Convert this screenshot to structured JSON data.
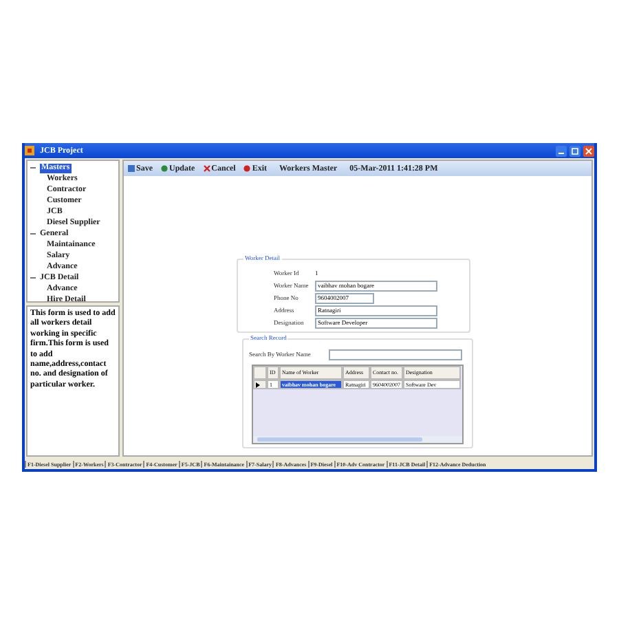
{
  "window": {
    "title": "JCB Project"
  },
  "tree": [
    {
      "label": "Masters",
      "selected": true,
      "expanded": true,
      "children": [
        {
          "label": "Workers"
        },
        {
          "label": "Contractor"
        },
        {
          "label": "Customer"
        },
        {
          "label": "JCB"
        },
        {
          "label": "Diesel Supplier"
        }
      ]
    },
    {
      "label": "General",
      "selected": false,
      "expanded": true,
      "children": [
        {
          "label": "Maintainance"
        },
        {
          "label": "Salary"
        },
        {
          "label": "Advance"
        }
      ]
    },
    {
      "label": "JCB Detail",
      "selected": false,
      "expanded": true,
      "children": [
        {
          "label": "Advance"
        },
        {
          "label": "Hire Detail"
        }
      ]
    }
  ],
  "description": "This form is used to add all workers detail working in specific firm.This form is used to add name,address,contact no. and designation of particular worker.",
  "toolbar": {
    "buttons": [
      {
        "label": "Save",
        "kind": "save"
      },
      {
        "label": "Update",
        "kind": "update"
      },
      {
        "label": "Cancel",
        "kind": "cancel"
      },
      {
        "label": "Exit",
        "kind": "exit"
      }
    ],
    "title": "Workers Master",
    "datetime": "05-Mar-2011 1:41:28 PM"
  },
  "worker_detail": {
    "legend": "Worker Detail",
    "fields": [
      {
        "label": "Worker Id",
        "value": "1",
        "kind": "text"
      },
      {
        "label": "Worker Name",
        "value": "vaibhav mohan bogare",
        "kind": "input"
      },
      {
        "label": "Phone No",
        "value": "9604002007",
        "kind": "short"
      },
      {
        "label": "Address",
        "value": "Ratnagiri",
        "kind": "input"
      },
      {
        "label": "Designation",
        "value": "Software Developer",
        "kind": "input"
      }
    ]
  },
  "search_record": {
    "legend": "Search Record",
    "search_label": "Search By Worker Name",
    "grid": {
      "columns": [
        "ID",
        "Name of Worker",
        "Address",
        "Contact no.",
        "Designation"
      ],
      "rows": [
        {
          "current": true,
          "cells": [
            "1",
            "vaibhav mohan bogare",
            "Ratnagiri",
            "9604002007",
            "Software Dev"
          ]
        }
      ]
    }
  },
  "status_bar": [
    "F1-Diesel Supplier",
    "F2-Workers",
    "F3-Contractor",
    "F4-Customer",
    "F5-JCB",
    "F6-Maintainance",
    "F7-Salary",
    "F8-Advances",
    "F9-Diesel",
    "F10-Adv Contractor",
    "F11-JCB Detail",
    "F12-Advance Deduction"
  ]
}
